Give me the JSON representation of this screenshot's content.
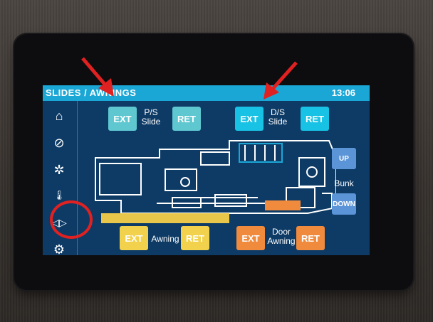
{
  "header": {
    "title": "SLIDES / AWNINGS",
    "time": "13:06"
  },
  "sidebar": {
    "items": [
      {
        "icon": "home-icon"
      },
      {
        "icon": "fan-icon"
      },
      {
        "icon": "light-bulb-icon"
      },
      {
        "icon": "thermostat-icon"
      },
      {
        "icon": "slide-out-icon"
      },
      {
        "icon": "gear-icon"
      }
    ]
  },
  "slides": {
    "ps": {
      "ext": "EXT",
      "label_line1": "P/S",
      "label_line2": "Slide",
      "ret": "RET"
    },
    "ds": {
      "ext": "EXT",
      "label_line1": "D/S",
      "label_line2": "Slide",
      "ret": "RET"
    }
  },
  "bunk": {
    "up": "UP",
    "label": "Bunk",
    "down": "DOWN"
  },
  "awnings": {
    "main": {
      "ext": "EXT",
      "label": "Awning",
      "ret": "RET"
    },
    "door": {
      "ext": "EXT",
      "label_line1": "Door",
      "label_line2": "Awning",
      "ret": "RET"
    }
  },
  "colors": {
    "topbar": "#1ba7d6",
    "screen_bg": "#0d3b66",
    "ps_buttons": "#5fc7d0",
    "ds_buttons": "#18c2e4",
    "awning_buttons": "#f2d24c",
    "door_awning_buttons": "#f08a3c",
    "bunk_buttons": "#5b95d8",
    "annotation": "#e02121"
  }
}
